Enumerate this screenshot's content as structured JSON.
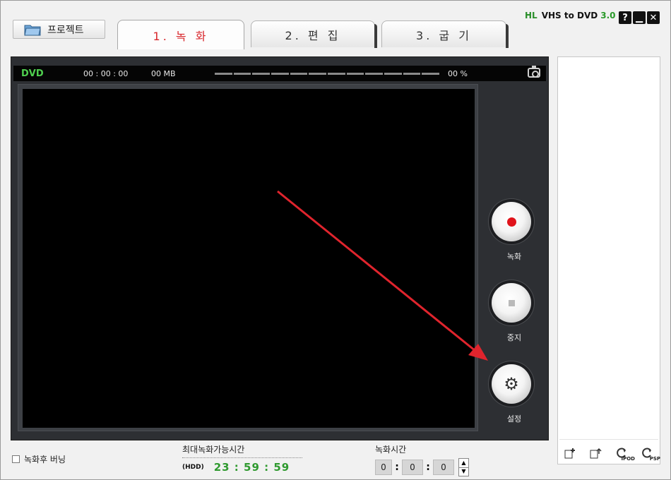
{
  "project_button": {
    "label": "프로젝트",
    "icon": "folder-icon"
  },
  "tabs": [
    {
      "label": "1. 녹 화",
      "active": true
    },
    {
      "label": "2. 편 집",
      "active": false
    },
    {
      "label": "3. 굽 기",
      "active": false
    }
  ],
  "brand": {
    "logo": "ᕼL",
    "name": "VHS to DVD",
    "version": "3.0"
  },
  "window_buttons": {
    "help": "?",
    "minimize": "▁",
    "close": "✕"
  },
  "status": {
    "format": "DVD",
    "time": "00 : 00 : 00",
    "size": "00 MB",
    "percent": "00 %",
    "progress_segments": 12,
    "progress": 0
  },
  "controls": {
    "record_label": "녹화",
    "stop_label": "중지",
    "settings_label": "설정"
  },
  "right_tools": {
    "tool1": "🗋",
    "tool2": "🗋",
    "tool3_badge": "IPOD",
    "tool4_badge": "PSP"
  },
  "burn_after": {
    "label": "녹화후 버닝",
    "checked": false
  },
  "max_time": {
    "label": "최대녹화가능시간",
    "drive": "(HDD)",
    "value": "23 : 59 : 59"
  },
  "record_time": {
    "label": "녹화시간",
    "hours": "0",
    "minutes": "0",
    "seconds": "0"
  },
  "colors": {
    "accent_red": "#d8262b",
    "green": "#2f9a2f",
    "panel_dark": "#2d2f33"
  }
}
